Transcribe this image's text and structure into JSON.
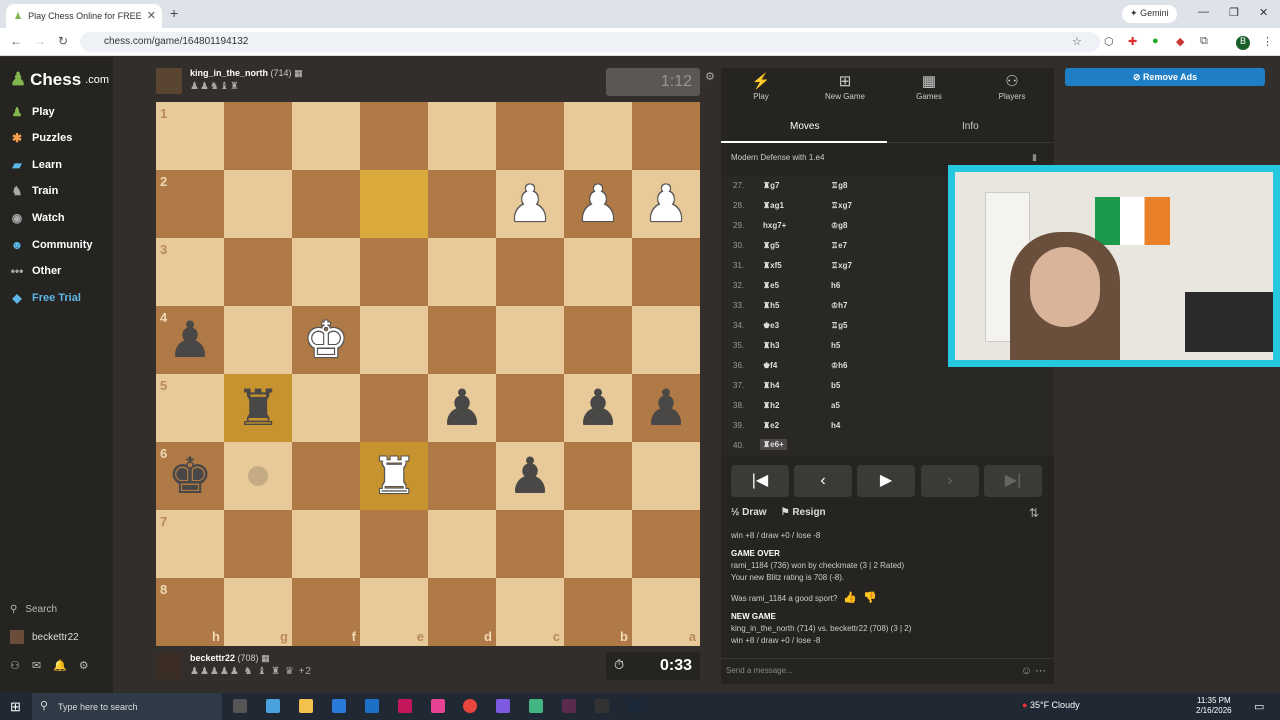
{
  "browser": {
    "tab_title": "Play Chess Online for FREE",
    "url": "chess.com/game/164801194132",
    "gemini_label": "Gemini"
  },
  "sidebar": {
    "logo": "Chess",
    "logo_suffix": ".com",
    "items": [
      {
        "label": "Play",
        "icon": "play-icon"
      },
      {
        "label": "Puzzles",
        "icon": "puzzle-icon"
      },
      {
        "label": "Learn",
        "icon": "learn-icon"
      },
      {
        "label": "Train",
        "icon": "train-icon"
      },
      {
        "label": "Watch",
        "icon": "watch-icon"
      },
      {
        "label": "Community",
        "icon": "community-icon"
      },
      {
        "label": "Other",
        "icon": "more-icon"
      },
      {
        "label": "Free Trial",
        "icon": "diamond-icon"
      }
    ],
    "search_label": "Search",
    "username": "beckettr22"
  },
  "top_player": {
    "name": "king_in_the_north",
    "rating": "(714)",
    "captured": "♟♟♞♝♜",
    "clock": "1:12"
  },
  "bottom_player": {
    "name": "beckettr22",
    "rating": "(708)",
    "captured": "♟♟♟♟♟ ♞ ♝ ♜ ♛ +2",
    "clock": "0:33"
  },
  "board": {
    "rank_labels": [
      "1",
      "2",
      "3",
      "4",
      "5",
      "6",
      "7",
      "8"
    ],
    "file_labels": [
      "h",
      "g",
      "f",
      "e",
      "d",
      "c",
      "b",
      "a"
    ],
    "pieces": [
      {
        "sq": "r1c5",
        "glyph": "♟",
        "side": "w"
      },
      {
        "sq": "r1c6",
        "glyph": "♟",
        "side": "w"
      },
      {
        "sq": "r1c7",
        "glyph": "♟",
        "side": "w"
      },
      {
        "sq": "r3c0",
        "glyph": "♟",
        "side": "b"
      },
      {
        "sq": "r3c2",
        "glyph": "♚",
        "side": "w"
      },
      {
        "sq": "r4c1",
        "glyph": "♜",
        "side": "b"
      },
      {
        "sq": "r4c4",
        "glyph": "♟",
        "side": "b"
      },
      {
        "sq": "r4c6",
        "glyph": "♟",
        "side": "b"
      },
      {
        "sq": "r4c7",
        "glyph": "♟",
        "side": "b"
      },
      {
        "sq": "r5c0",
        "glyph": "♚",
        "side": "b"
      },
      {
        "sq": "r5c3",
        "glyph": "♜",
        "side": "w"
      },
      {
        "sq": "r5c5",
        "glyph": "♟",
        "side": "b"
      }
    ]
  },
  "panel": {
    "tabs": [
      "Play",
      "New Game",
      "Games",
      "Players"
    ],
    "subtabs": [
      "Moves",
      "Info"
    ],
    "opening": "Modern Defense with 1.e4",
    "moves": [
      {
        "n": "27.",
        "w": "♜g7",
        "b": "♖g8"
      },
      {
        "n": "28.",
        "w": "♜ag1",
        "b": "♖xg7"
      },
      {
        "n": "29.",
        "w": "hxg7+",
        "b": "♔g8"
      },
      {
        "n": "30.",
        "w": "♜g5",
        "b": "♖e7"
      },
      {
        "n": "31.",
        "w": "♜xf5",
        "b": "♖xg7"
      },
      {
        "n": "32.",
        "w": "♜e5",
        "b": "h6"
      },
      {
        "n": "33.",
        "w": "♜h5",
        "b": "♔h7"
      },
      {
        "n": "34.",
        "w": "♚e3",
        "b": "♖g5"
      },
      {
        "n": "35.",
        "w": "♜h3",
        "b": "h5"
      },
      {
        "n": "36.",
        "w": "♚f4",
        "b": "♔h6"
      },
      {
        "n": "37.",
        "w": "♜h4",
        "b": "b5"
      },
      {
        "n": "38.",
        "w": "♜h2",
        "b": "a5"
      },
      {
        "n": "39.",
        "w": "♜e2",
        "b": "h4"
      },
      {
        "n": "40.",
        "w": "♜e6+",
        "b": ""
      }
    ],
    "draw_label": "Draw",
    "resign_label": "Resign",
    "chat": {
      "line0": "win +8 / draw +0 / lose -8",
      "game_over": "GAME OVER",
      "result": "rami_1184 (736) won by checkmate (3 | 2 Rated)",
      "rating_change": "Your new Blitz rating is 708 (-8).",
      "sport": "Was rami_1184 a good sport?",
      "new_game": "NEW GAME",
      "match": "king_in_the_north (714) vs. beckettr22 (708) (3 | 2)",
      "line_last": "win +8 / draw +0 / lose -8"
    },
    "chat_placeholder": "Send a message..."
  },
  "remove_ads": "Remove Ads",
  "taskbar": {
    "search_placeholder": "Type here to search",
    "weather": "35°F  Cloudy",
    "time": "11:35 PM",
    "date": "2/16/2026"
  }
}
